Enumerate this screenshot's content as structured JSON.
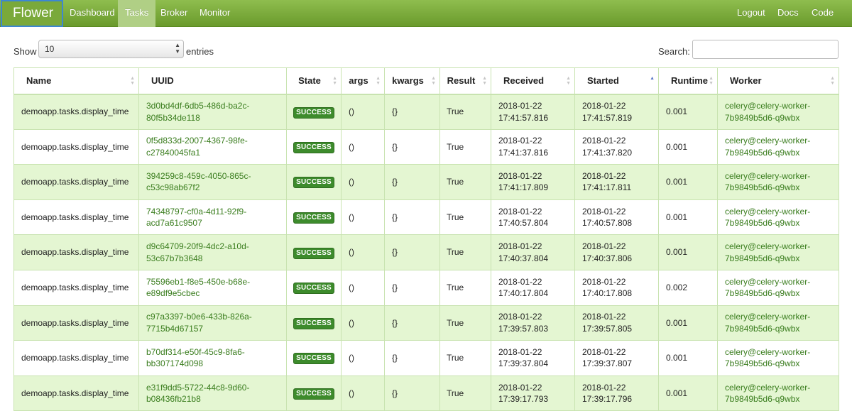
{
  "navbar": {
    "brand": "Flower",
    "items": [
      {
        "label": "Dashboard",
        "active": false
      },
      {
        "label": "Tasks",
        "active": true
      },
      {
        "label": "Broker",
        "active": false
      },
      {
        "label": "Monitor",
        "active": false
      }
    ],
    "right_items": [
      {
        "label": "Logout"
      },
      {
        "label": "Docs"
      },
      {
        "label": "Code"
      }
    ]
  },
  "controls": {
    "show_label": "Show",
    "entries_value": "10",
    "entries_label": "entries",
    "search_label": "Search:",
    "search_value": ""
  },
  "table": {
    "sorted_column": "Started",
    "sort_direction": "ascending",
    "columns": [
      "Name",
      "UUID",
      "State",
      "args",
      "kwargs",
      "Result",
      "Received",
      "Started",
      "Runtime",
      "Worker"
    ],
    "rows": [
      {
        "name": "demoapp.tasks.display_time",
        "uuid_1": "3d0bd4df-6db5-486d-ba2c-",
        "uuid_2": "80f5b34de118",
        "state": "SUCCESS",
        "args": "()",
        "kwargs": "{}",
        "result": "True",
        "received_date": "2018-01-22",
        "received_time": "17:41:57.816",
        "started_date": "2018-01-22",
        "started_time": "17:41:57.819",
        "runtime": "0.001",
        "worker_1": "celery@celery-worker-",
        "worker_2": "7b9849b5d6-q9wbx"
      },
      {
        "name": "demoapp.tasks.display_time",
        "uuid_1": "0f5d833d-2007-4367-98fe-",
        "uuid_2": "c27840045fa1",
        "state": "SUCCESS",
        "args": "()",
        "kwargs": "{}",
        "result": "True",
        "received_date": "2018-01-22",
        "received_time": "17:41:37.816",
        "started_date": "2018-01-22",
        "started_time": "17:41:37.820",
        "runtime": "0.001",
        "worker_1": "celery@celery-worker-",
        "worker_2": "7b9849b5d6-q9wbx"
      },
      {
        "name": "demoapp.tasks.display_time",
        "uuid_1": "394259c8-459c-4050-865c-",
        "uuid_2": "c53c98ab67f2",
        "state": "SUCCESS",
        "args": "()",
        "kwargs": "{}",
        "result": "True",
        "received_date": "2018-01-22",
        "received_time": "17:41:17.809",
        "started_date": "2018-01-22",
        "started_time": "17:41:17.811",
        "runtime": "0.001",
        "worker_1": "celery@celery-worker-",
        "worker_2": "7b9849b5d6-q9wbx"
      },
      {
        "name": "demoapp.tasks.display_time",
        "uuid_1": "74348797-cf0a-4d11-92f9-",
        "uuid_2": "acd7a61c9507",
        "state": "SUCCESS",
        "args": "()",
        "kwargs": "{}",
        "result": "True",
        "received_date": "2018-01-22",
        "received_time": "17:40:57.804",
        "started_date": "2018-01-22",
        "started_time": "17:40:57.808",
        "runtime": "0.001",
        "worker_1": "celery@celery-worker-",
        "worker_2": "7b9849b5d6-q9wbx"
      },
      {
        "name": "demoapp.tasks.display_time",
        "uuid_1": "d9c64709-20f9-4dc2-a10d-",
        "uuid_2": "53c67b7b3648",
        "state": "SUCCESS",
        "args": "()",
        "kwargs": "{}",
        "result": "True",
        "received_date": "2018-01-22",
        "received_time": "17:40:37.804",
        "started_date": "2018-01-22",
        "started_time": "17:40:37.806",
        "runtime": "0.001",
        "worker_1": "celery@celery-worker-",
        "worker_2": "7b9849b5d6-q9wbx"
      },
      {
        "name": "demoapp.tasks.display_time",
        "uuid_1": "75596eb1-f8e5-450e-b68e-",
        "uuid_2": "e89df9e5cbec",
        "state": "SUCCESS",
        "args": "()",
        "kwargs": "{}",
        "result": "True",
        "received_date": "2018-01-22",
        "received_time": "17:40:17.804",
        "started_date": "2018-01-22",
        "started_time": "17:40:17.808",
        "runtime": "0.002",
        "worker_1": "celery@celery-worker-",
        "worker_2": "7b9849b5d6-q9wbx"
      },
      {
        "name": "demoapp.tasks.display_time",
        "uuid_1": "c97a3397-b0e6-433b-826a-",
        "uuid_2": "7715b4d67157",
        "state": "SUCCESS",
        "args": "()",
        "kwargs": "{}",
        "result": "True",
        "received_date": "2018-01-22",
        "received_time": "17:39:57.803",
        "started_date": "2018-01-22",
        "started_time": "17:39:57.805",
        "runtime": "0.001",
        "worker_1": "celery@celery-worker-",
        "worker_2": "7b9849b5d6-q9wbx"
      },
      {
        "name": "demoapp.tasks.display_time",
        "uuid_1": "b70df314-e50f-45c9-8fa6-",
        "uuid_2": "bb307174d098",
        "state": "SUCCESS",
        "args": "()",
        "kwargs": "{}",
        "result": "True",
        "received_date": "2018-01-22",
        "received_time": "17:39:37.804",
        "started_date": "2018-01-22",
        "started_time": "17:39:37.807",
        "runtime": "0.001",
        "worker_1": "celery@celery-worker-",
        "worker_2": "7b9849b5d6-q9wbx"
      },
      {
        "name": "demoapp.tasks.display_time",
        "uuid_1": "e31f9dd5-5722-44c8-9d60-",
        "uuid_2": "b08436fb21b8",
        "state": "SUCCESS",
        "args": "()",
        "kwargs": "{}",
        "result": "True",
        "received_date": "2018-01-22",
        "received_time": "17:39:17.793",
        "started_date": "2018-01-22",
        "started_time": "17:39:17.796",
        "runtime": "0.001",
        "worker_1": "celery@celery-worker-",
        "worker_2": "7b9849b5d6-q9wbx"
      }
    ]
  },
  "colors": {
    "navbar": "#7fad3f",
    "active_tab": "#b0cf85",
    "link": "#3a7d1e",
    "row_striped": "#e4f6d2",
    "badge_success": "#3d8b2c",
    "sort_active": "#5b78c7"
  }
}
